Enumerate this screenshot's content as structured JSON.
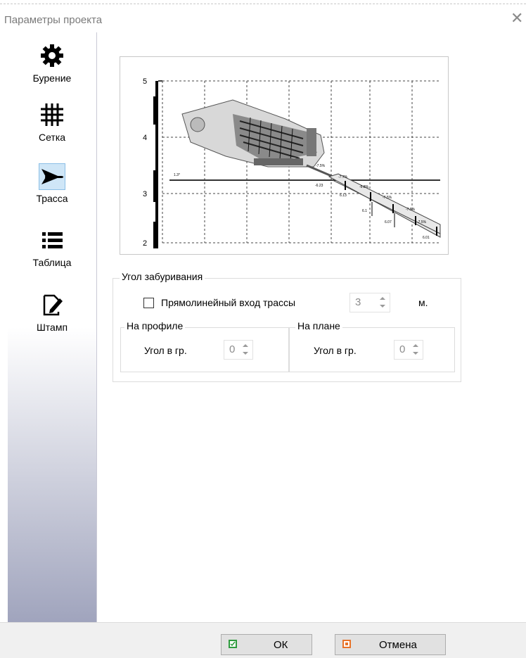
{
  "window": {
    "title": "Параметры проекта",
    "close_symbol": "✕"
  },
  "sidebar": {
    "items": [
      {
        "label": "Бурение",
        "icon": "gear-icon"
      },
      {
        "label": "Сетка",
        "icon": "grid-icon"
      },
      {
        "label": "Трасса",
        "icon": "route-icon",
        "selected": true
      },
      {
        "label": "Таблица",
        "icon": "list-icon"
      },
      {
        "label": "Штамп",
        "icon": "stamp-edit-icon"
      }
    ]
  },
  "preview": {
    "y_ticks": [
      "5",
      "4",
      "3",
      "2"
    ],
    "annotations": [
      "1.3*",
      "-7.5%",
      "-7.7%",
      "-6.8%",
      "-6.23",
      "-7.5%",
      "6.13",
      "-7.5%",
      "6.1",
      "-7.5%",
      "6.07",
      "6.01"
    ]
  },
  "entry_angle": {
    "group_title": "Угол забуривания",
    "straight_entry_label": "Прямолинейный вход трассы",
    "straight_entry_checked": false,
    "length_value": "3",
    "length_unit": "м.",
    "profile": {
      "group_title": "На профиле",
      "angle_label": "Угол в гр.",
      "angle_value": "0"
    },
    "plan": {
      "group_title": "На плане",
      "angle_label": "Угол в гр.",
      "angle_value": "0"
    }
  },
  "footer": {
    "ok_label": "ОК",
    "cancel_label": "Отмена"
  },
  "colors": {
    "ok_icon": "#2e9b3e",
    "cancel_icon": "#e8732a",
    "selected_nav": "#cfe6f7"
  }
}
